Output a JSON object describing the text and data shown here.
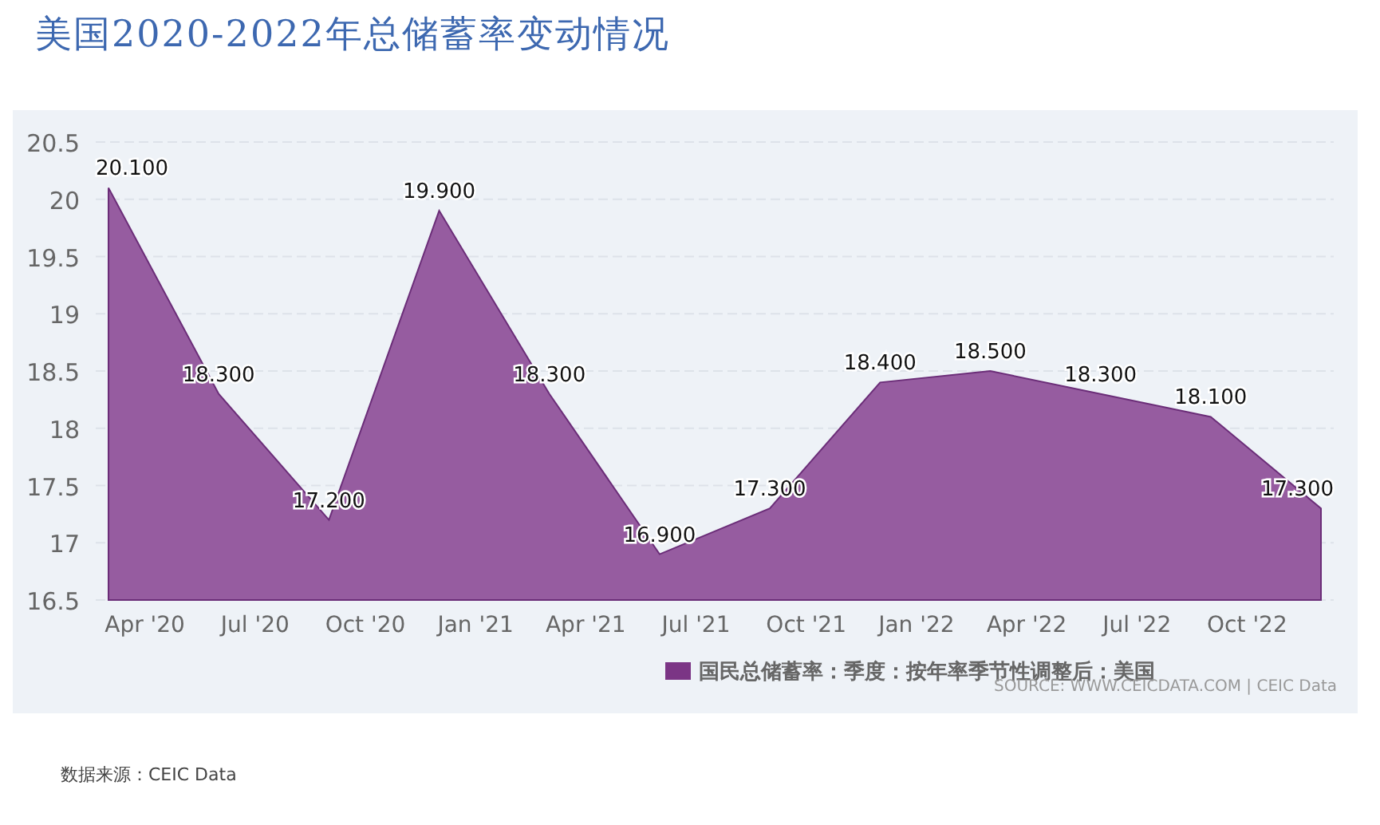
{
  "title": "美国2020-2022年总储蓄率变动情况",
  "chart": {
    "source": "SOURCE: WWW.CEICDATA.COM | CEIC Data",
    "chart_data": {
      "type": "area",
      "categories": [
        "Apr '20",
        "Jul '20",
        "Oct '20",
        "Jan '21",
        "Apr '21",
        "Jul '21",
        "Oct '21",
        "Jan '22",
        "Apr '22",
        "Jul '22",
        "Oct '22",
        null
      ],
      "series": [
        {
          "name": "国民总储蓄率：季度：按年率季节性调整后：美国",
          "color": "#965ca0",
          "values": [
            20.1,
            18.3,
            17.2,
            19.9,
            18.3,
            16.9,
            17.3,
            18.4,
            18.5,
            18.3,
            18.1,
            17.3
          ]
        }
      ],
      "value_labels": [
        "20.100",
        "18.300",
        "17.200",
        "19.900",
        "18.300",
        "16.900",
        "17.300",
        "18.400",
        "18.500",
        "18.300",
        "18.100",
        "17.300"
      ],
      "ylim": [
        16.5,
        20.5
      ],
      "grid": true,
      "yticks": [
        {
          "value": 16.5,
          "label": "16.5"
        },
        {
          "value": 17,
          "label": "17"
        },
        {
          "value": 17.5,
          "label": "17.5"
        },
        {
          "value": 18,
          "label": "18"
        },
        {
          "value": 18.5,
          "label": "18.5"
        },
        {
          "value": 19,
          "label": "19"
        },
        {
          "value": 19.5,
          "label": "19.5"
        },
        {
          "value": 20,
          "label": "20"
        },
        {
          "value": 20.5,
          "label": "20.5"
        }
      ]
    }
  },
  "footer": "数据来源：CEIC Data"
}
